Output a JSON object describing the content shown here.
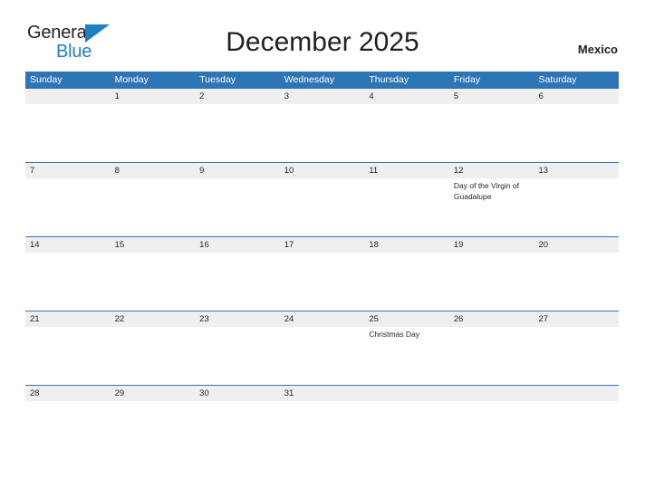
{
  "logo": {
    "word_one": "General",
    "word_two": "Blue",
    "flag_icon": "blue-triangle-flag-icon",
    "blue": "#1f7fc4"
  },
  "header": {
    "title": "December 2025",
    "country": "Mexico"
  },
  "theme": {
    "header_blue": "#2e75b6",
    "row_gray": "#efefef",
    "text": "#231f20",
    "page_background": "#ffffff"
  },
  "calendar": {
    "month": "December",
    "year": "2025",
    "day_headers": [
      "Sunday",
      "Monday",
      "Tuesday",
      "Wednesday",
      "Thursday",
      "Friday",
      "Saturday"
    ],
    "weeks": [
      {
        "days": [
          {
            "number": "",
            "event": ""
          },
          {
            "number": "1",
            "event": ""
          },
          {
            "number": "2",
            "event": ""
          },
          {
            "number": "3",
            "event": ""
          },
          {
            "number": "4",
            "event": ""
          },
          {
            "number": "5",
            "event": ""
          },
          {
            "number": "6",
            "event": ""
          }
        ]
      },
      {
        "days": [
          {
            "number": "7",
            "event": ""
          },
          {
            "number": "8",
            "event": ""
          },
          {
            "number": "9",
            "event": ""
          },
          {
            "number": "10",
            "event": ""
          },
          {
            "number": "11",
            "event": ""
          },
          {
            "number": "12",
            "event": "Day of the Virgin of Guadalupe"
          },
          {
            "number": "13",
            "event": ""
          }
        ]
      },
      {
        "days": [
          {
            "number": "14",
            "event": ""
          },
          {
            "number": "15",
            "event": ""
          },
          {
            "number": "16",
            "event": ""
          },
          {
            "number": "17",
            "event": ""
          },
          {
            "number": "18",
            "event": ""
          },
          {
            "number": "19",
            "event": ""
          },
          {
            "number": "20",
            "event": ""
          }
        ]
      },
      {
        "days": [
          {
            "number": "21",
            "event": ""
          },
          {
            "number": "22",
            "event": ""
          },
          {
            "number": "23",
            "event": ""
          },
          {
            "number": "24",
            "event": ""
          },
          {
            "number": "25",
            "event": "Christmas Day"
          },
          {
            "number": "26",
            "event": ""
          },
          {
            "number": "27",
            "event": ""
          }
        ]
      },
      {
        "days": [
          {
            "number": "28",
            "event": ""
          },
          {
            "number": "29",
            "event": ""
          },
          {
            "number": "30",
            "event": ""
          },
          {
            "number": "31",
            "event": ""
          },
          {
            "number": "",
            "event": ""
          },
          {
            "number": "",
            "event": ""
          },
          {
            "number": "",
            "event": ""
          }
        ]
      }
    ]
  }
}
